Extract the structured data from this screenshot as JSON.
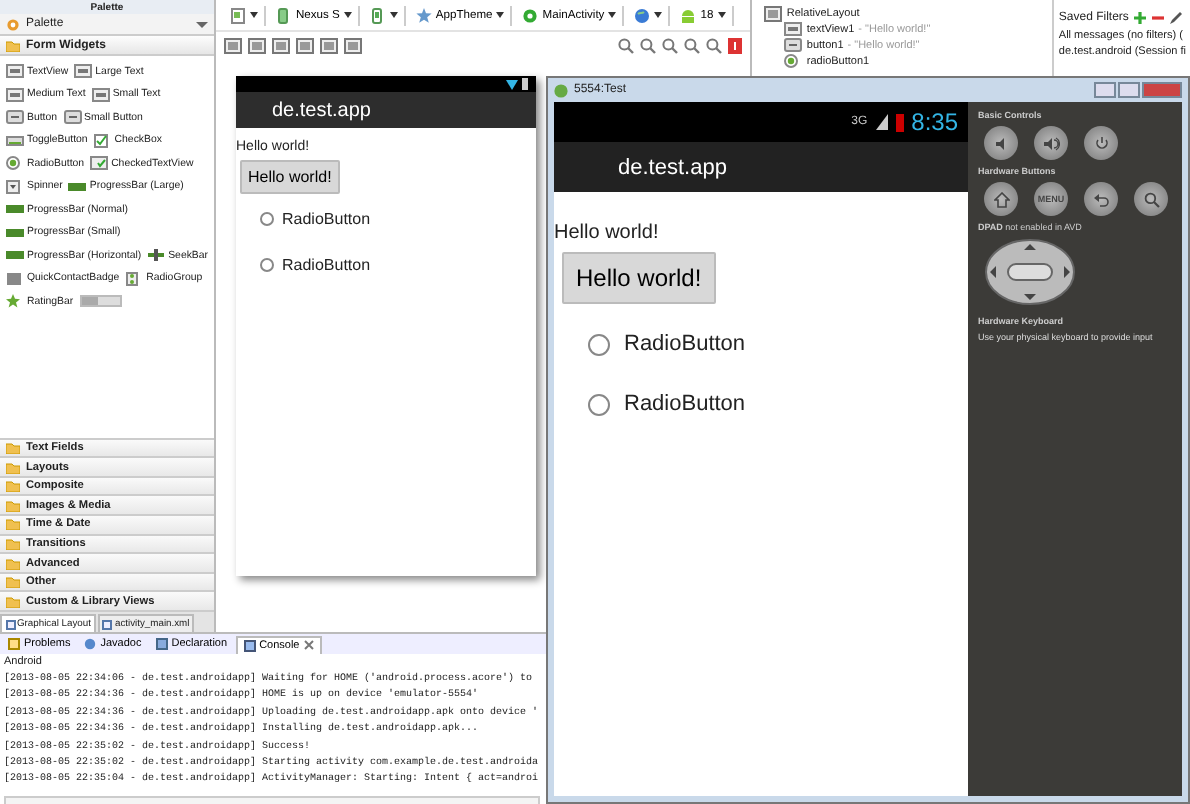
{
  "palette": {
    "tab_label": "Palette",
    "title": "Palette",
    "section": "Form Widgets",
    "widget_rows": [
      [
        {
          "kind": "text",
          "label": "TextView"
        },
        {
          "kind": "text",
          "label": "Large Text"
        }
      ],
      [
        {
          "kind": "text",
          "label": "Medium Text"
        },
        {
          "kind": "text",
          "label": "Small Text"
        }
      ],
      [
        {
          "kind": "button",
          "label": "Button"
        },
        {
          "kind": "button",
          "label": "Small Button"
        }
      ],
      [
        {
          "kind": "toggle",
          "label": "ToggleButton"
        },
        {
          "kind": "check",
          "label": "CheckBox"
        }
      ],
      [
        {
          "kind": "radio",
          "label": "RadioButton"
        },
        {
          "kind": "checked",
          "label": "CheckedTextView"
        }
      ],
      [
        {
          "kind": "spinner",
          "label": "Spinner"
        },
        {
          "kind": "progress",
          "label": "ProgressBar (Large)"
        }
      ],
      [
        {
          "kind": "progress",
          "label": "ProgressBar (Normal)"
        }
      ],
      [
        {
          "kind": "progress",
          "label": "ProgressBar (Small)"
        }
      ],
      [
        {
          "kind": "progress",
          "label": "ProgressBar (Horizontal)"
        },
        {
          "kind": "seek",
          "label": "SeekBar"
        }
      ],
      [
        {
          "kind": "badge",
          "label": "QuickContactBadge"
        },
        {
          "kind": "group",
          "label": "RadioGroup"
        }
      ],
      [
        {
          "kind": "rating",
          "label": "RatingBar"
        },
        {
          "kind": "bar"
        }
      ]
    ],
    "categories": [
      "Text Fields",
      "Layouts",
      "Composite",
      "Images & Media",
      "Time & Date",
      "Transitions",
      "Advanced",
      "Other",
      "Custom & Library Views"
    ]
  },
  "editor_tabs": [
    {
      "label": "Graphical Layout",
      "selected": true
    },
    {
      "label": "activity_main.xml",
      "selected": false
    }
  ],
  "toolbar": {
    "items": [
      {
        "kind": "doc"
      },
      {
        "kind": "device",
        "label": "Nexus S"
      },
      {
        "kind": "rotate"
      },
      {
        "kind": "theme",
        "label": "AppTheme"
      },
      {
        "kind": "activity",
        "label": "MainActivity"
      },
      {
        "kind": "locale"
      },
      {
        "kind": "api",
        "label": "18"
      }
    ]
  },
  "preview": {
    "app_title": "de.test.app",
    "text": "Hello world!",
    "button": "Hello world!",
    "radios": [
      {
        "label": "RadioButton",
        "selected": false
      },
      {
        "label": "RadioButton",
        "selected": false
      }
    ]
  },
  "outline": {
    "tree": [
      {
        "label": "RelativeLayout",
        "kind": "layout",
        "children": [
          {
            "label": "textView1",
            "value": "- \"Hello world!\"",
            "kind": "text"
          },
          {
            "label": "button1",
            "value": "- \"Hello world!\"",
            "kind": "button"
          },
          {
            "label": "radioButton1",
            "kind": "radio"
          }
        ]
      }
    ]
  },
  "saved_filters": {
    "title": "Saved Filters",
    "items": [
      "All messages (no filters) (",
      "de.test.android (Session fi"
    ]
  },
  "bottom_tabs": [
    {
      "label": "Problems",
      "kind": "problems",
      "selected": false
    },
    {
      "label": "Javadoc",
      "kind": "javadoc",
      "selected": false
    },
    {
      "label": "Declaration",
      "kind": "declaration",
      "selected": false
    },
    {
      "label": "Console",
      "kind": "console",
      "selected": true
    }
  ],
  "console": {
    "title": "Android",
    "lines": [
      "[2013-08-05 22:34:06 - de.test.androidapp] Waiting for HOME ('android.process.acore') to",
      "[2013-08-05 22:34:36 - de.test.androidapp] HOME is up on device 'emulator-5554'",
      "[2013-08-05 22:34:36 - de.test.androidapp] Uploading de.test.androidapp.apk onto device '",
      "[2013-08-05 22:34:36 - de.test.androidapp] Installing de.test.androidapp.apk...",
      "[2013-08-05 22:35:02 - de.test.androidapp] Success!",
      "[2013-08-05 22:35:02 - de.test.androidapp] Starting activity com.example.de.test.androida",
      "[2013-08-05 22:35:04 - de.test.androidapp] ActivityManager: Starting: Intent { act=androi"
    ]
  },
  "emulator": {
    "title": "5554:Test",
    "network": "3G",
    "time": "8:35",
    "app_title": "de.test.app",
    "text": "Hello world!",
    "button": "Hello world!",
    "radios": [
      {
        "label": "RadioButton",
        "selected": false
      },
      {
        "label": "RadioButton",
        "selected": false
      }
    ],
    "controls": {
      "basic_title": "Basic Controls",
      "hardware_title": "Hardware Buttons",
      "menu_label": "MENU",
      "dpad_title": "**DPAD** not enabled in AVD",
      "keyboard_title": "Hardware Keyboard",
      "keyboard_note": "Use your physical keyboard to provide input"
    }
  }
}
